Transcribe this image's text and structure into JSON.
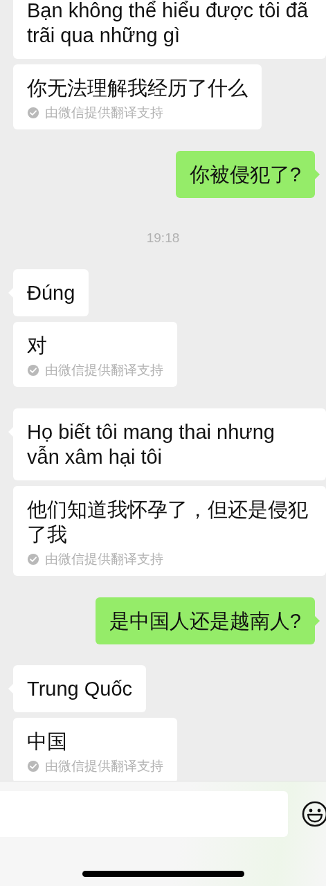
{
  "messages": [
    {
      "kind": "incoming",
      "text": "Bạn không thể hiểu được tôi đã trãi qua những gì",
      "tail": false
    },
    {
      "kind": "translation",
      "text": "你无法理解我经历了什么",
      "note": "由微信提供翻译支持"
    },
    {
      "kind": "outgoing",
      "text": "你被侵犯了?",
      "tail": true
    },
    {
      "kind": "time",
      "text": "19:18"
    },
    {
      "kind": "incoming",
      "text": "Đúng",
      "tail": true
    },
    {
      "kind": "translation",
      "text": "对",
      "note": "由微信提供翻译支持"
    },
    {
      "kind": "incoming",
      "text": "Họ biết tôi mang thai nhưng vẫn xâm hại tôi",
      "tail": true
    },
    {
      "kind": "translation",
      "text": "他们知道我怀孕了，但还是侵犯了我",
      "note": "由微信提供翻译支持"
    },
    {
      "kind": "outgoing",
      "text": "是中国人还是越南人?",
      "tail": true
    },
    {
      "kind": "incoming",
      "text": "Trung Quốc",
      "tail": true
    },
    {
      "kind": "translation",
      "text": "中国",
      "note": "由微信提供翻译支持"
    }
  ]
}
